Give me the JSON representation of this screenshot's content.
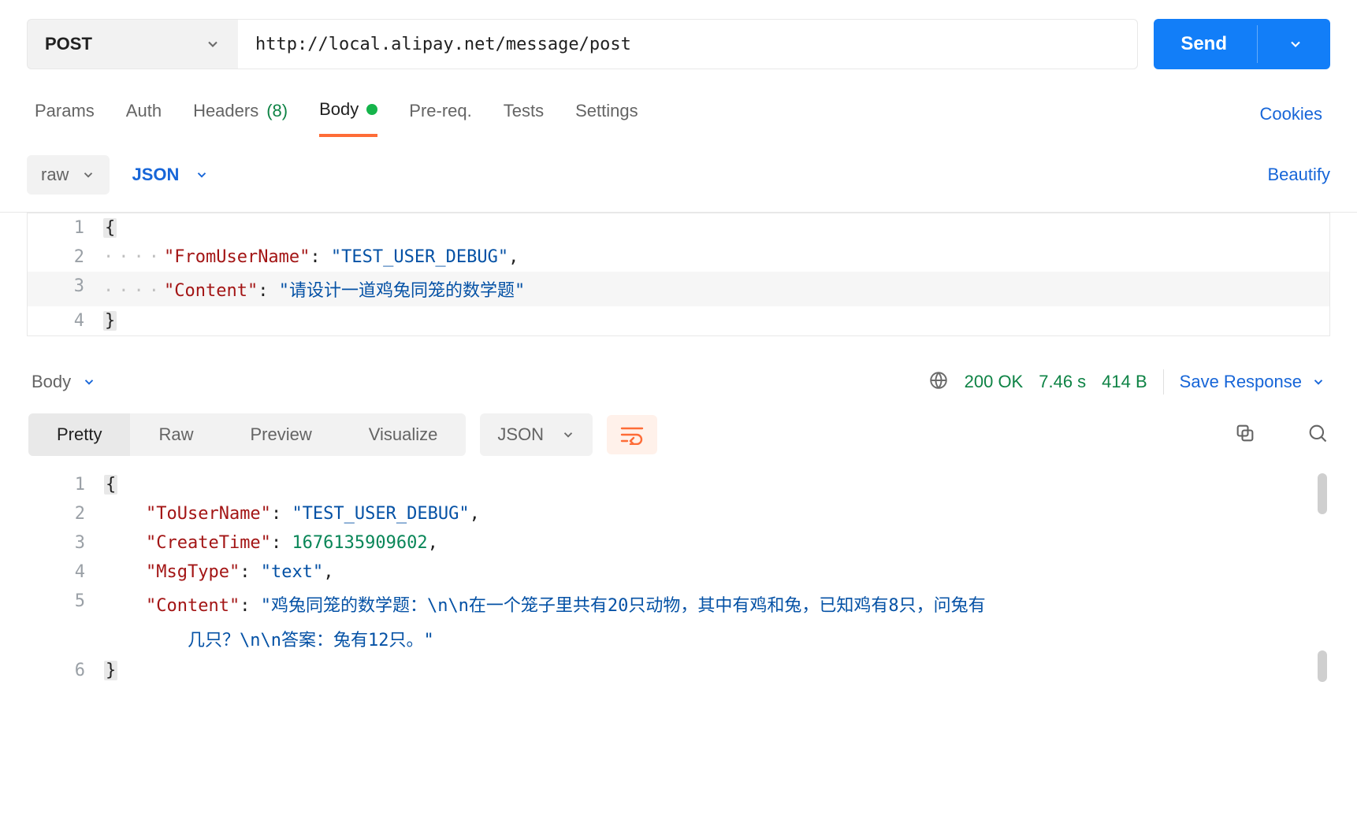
{
  "request": {
    "method": "POST",
    "url": "http://local.alipay.net/message/post",
    "sendLabel": "Send"
  },
  "tabs": {
    "params": "Params",
    "auth": "Auth",
    "headersLabel": "Headers",
    "headersCount": "(8)",
    "body": "Body",
    "prereq": "Pre-req.",
    "tests": "Tests",
    "settings": "Settings",
    "cookies": "Cookies"
  },
  "bodyControls": {
    "raw": "raw",
    "format": "JSON",
    "beautify": "Beautify"
  },
  "reqEditor": {
    "l1no": "1",
    "l2no": "2",
    "l3no": "3",
    "l4no": "4",
    "openBrace": "{",
    "closeBrace": "}",
    "dots": "····",
    "key1": "\"FromUserName\"",
    "val1": "\"TEST_USER_DEBUG\"",
    "comma": ",",
    "colon": ":",
    "colonSp": ": ",
    "key2": "\"Content\"",
    "val2": "\"请设计一道鸡兔同笼的数学题\""
  },
  "responseMeta": {
    "bodyLabel": "Body",
    "status": "200 OK",
    "time": "7.46 s",
    "size": "414 B",
    "saveResponse": "Save Response"
  },
  "respToolbar": {
    "pretty": "Pretty",
    "raw": "Raw",
    "preview": "Preview",
    "visualize": "Visualize",
    "format": "JSON"
  },
  "respEditor": {
    "l1no": "1",
    "l2no": "2",
    "l3no": "3",
    "l4no": "4",
    "l5no": "5",
    "l6no": "6",
    "openBrace": "{",
    "closeBrace": "}",
    "colonSp": ": ",
    "comma": ",",
    "k1": "\"ToUserName\"",
    "v1": "\"TEST_USER_DEBUG\"",
    "k2": "\"CreateTime\"",
    "v2": "1676135909602",
    "k3": "\"MsgType\"",
    "v3": "\"text\"",
    "k4": "\"Content\"",
    "v4a": "\"鸡兔同笼的数学题：\\n\\n在一个笼子里共有20只动物，其中有鸡和兔，已知鸡有8只，问兔有",
    "v4b": "几只？\\n\\n答案：兔有12只。\""
  }
}
